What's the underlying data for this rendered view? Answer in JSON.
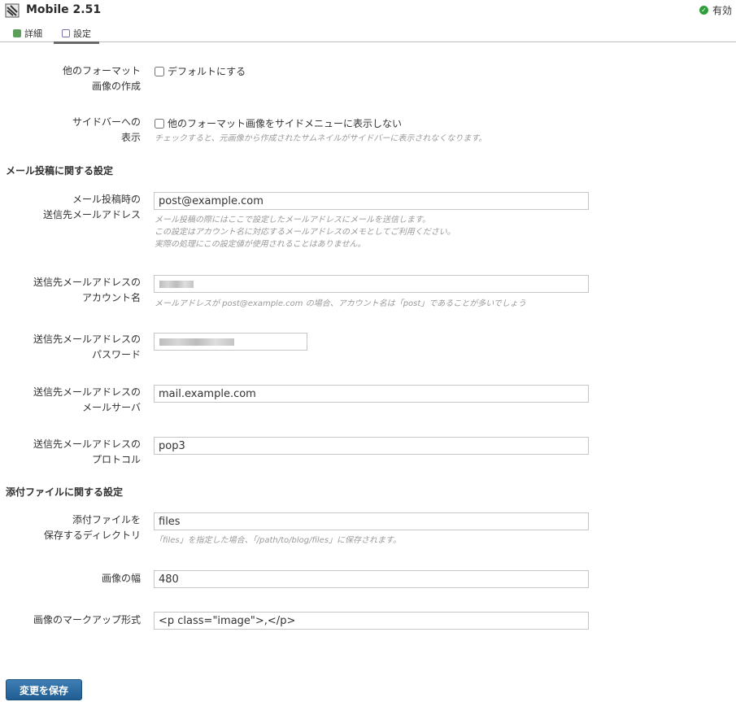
{
  "header": {
    "title": "Mobile 2.51",
    "status_label": "有効"
  },
  "tabs": [
    {
      "label": "詳細"
    },
    {
      "label": "設定"
    }
  ],
  "options": {
    "other_format": {
      "label_line1": "他のフォーマット",
      "label_line2": "画像の作成",
      "checkbox_label": "デフォルトにする",
      "checked": false
    },
    "sidebar": {
      "label_line1": "サイドバーへの",
      "label_line2": "表示",
      "checkbox_label": "他のフォーマット画像をサイドメニューに表示しない",
      "checked": false,
      "hint": "チェックすると、元画像から作成されたサムネイルがサイドバーに表示されなくなります。"
    }
  },
  "mail_section": {
    "title": "メール投稿に関する設定",
    "address": {
      "label_line1": "メール投稿時の",
      "label_line2": "送信先メールアドレス",
      "value": "post@example.com",
      "hint_line1": "メール投稿の際にはここで設定したメールアドレスにメールを送信します。",
      "hint_line2": "この設定はアカウント名に対応するメールアドレスのメモとしてご利用ください。",
      "hint_line3": "実際の処理にこの設定値が使用されることはありません。"
    },
    "account": {
      "label_line1": "送信先メールアドレスの",
      "label_line2": "アカウント名",
      "value": "",
      "hint": "メールアドレスが post@example.com の場合、アカウント名は「post」であることが多いでしょう"
    },
    "password": {
      "label_line1": "送信先メールアドレスの",
      "label_line2": "パスワード",
      "value": ""
    },
    "server": {
      "label_line1": "送信先メールアドレスの",
      "label_line2": "メールサーバ",
      "value": "mail.example.com"
    },
    "protocol": {
      "label_line1": "送信先メールアドレスの",
      "label_line2": "プロトコル",
      "value": "pop3"
    }
  },
  "attachment_section": {
    "title": "添付ファイルに関する設定",
    "directory": {
      "label_line1": "添付ファイルを",
      "label_line2": "保存するディレクトリ",
      "value": "files",
      "hint": "「files」を指定した場合、「/path/to/blog/files」に保存されます。"
    },
    "image_width": {
      "label": "画像の幅",
      "value": "480"
    },
    "markup": {
      "label": "画像のマークアップ形式",
      "value": "<p class=\"image\">,</p>"
    }
  },
  "save_button": {
    "label": "変更を保存"
  },
  "colors": {
    "accent": "#1f5d92",
    "status_ok": "#2e9e3a",
    "hint_text": "#9a9a9a"
  }
}
